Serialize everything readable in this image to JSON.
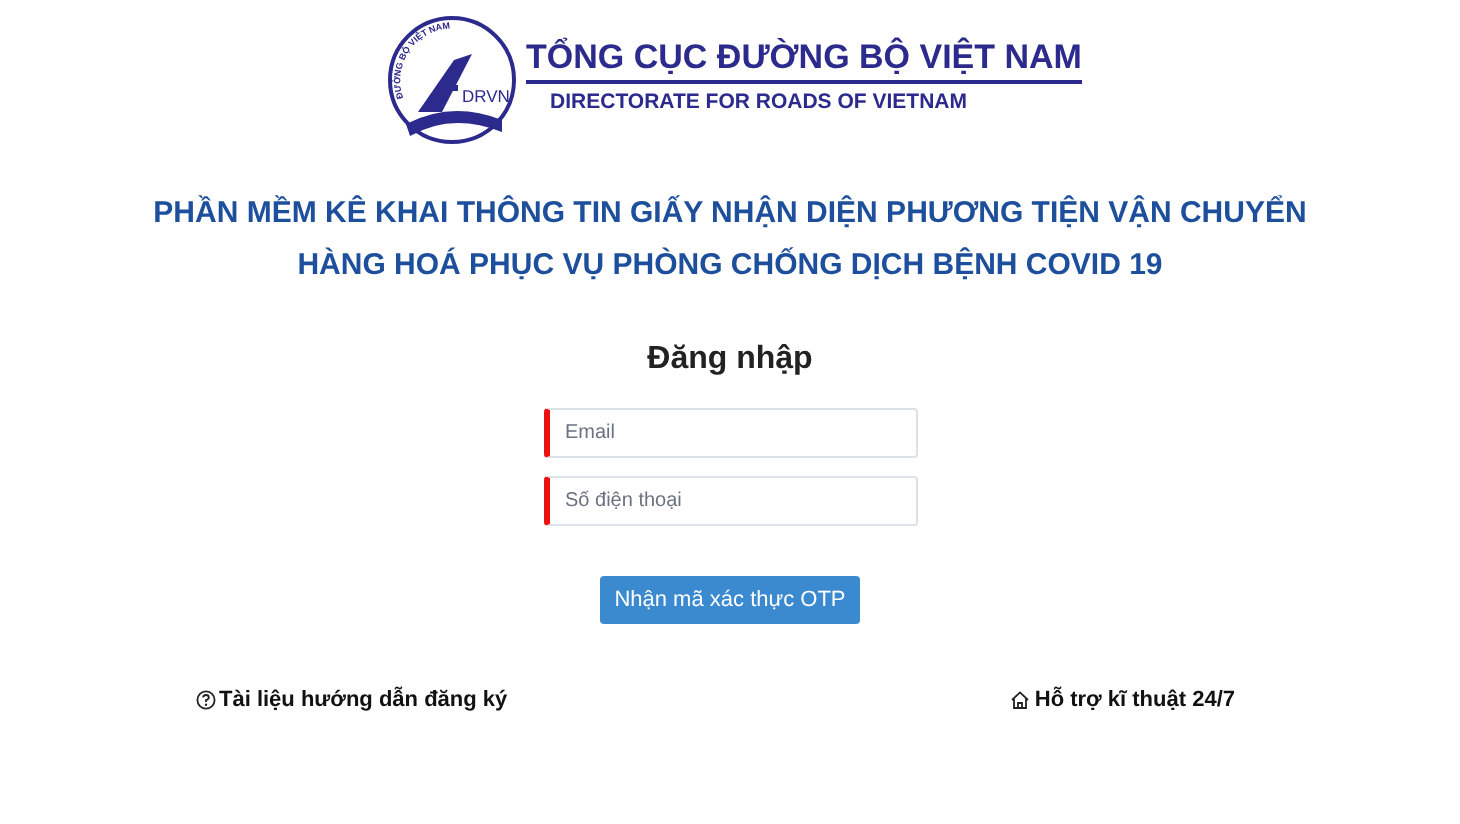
{
  "logo": {
    "emblem_arc": "ĐƯỜNG BỘ VIỆT NAM",
    "emblem_mark": "DRVN",
    "name": "TỔNG CỤC ĐƯỜNG BỘ VIỆT NAM",
    "name_en": "DIRECTORATE FOR ROADS OF VIETNAM"
  },
  "headline": [
    "PHẦN MỀM KÊ KHAI THÔNG TIN GIẤY NHẬN DIỆN PHƯƠNG TIỆN VẬN CHUYỂN",
    "HÀNG HOÁ PHỤC VỤ PHÒNG CHỐNG DỊCH BỆNH COVID 19"
  ],
  "login": {
    "title": "Đăng nhập",
    "fields": [
      {
        "placeholder": "Email",
        "required": true
      },
      {
        "placeholder": "Số điện thoại",
        "required": true
      }
    ],
    "button": "Nhận mã xác thực OTP"
  },
  "links": [
    {
      "kind": "help",
      "label": "Tài liệu hướng dẫn đăng ký"
    },
    {
      "kind": "home",
      "label": "Hỗ trợ kĩ thuật 24/7"
    }
  ]
}
